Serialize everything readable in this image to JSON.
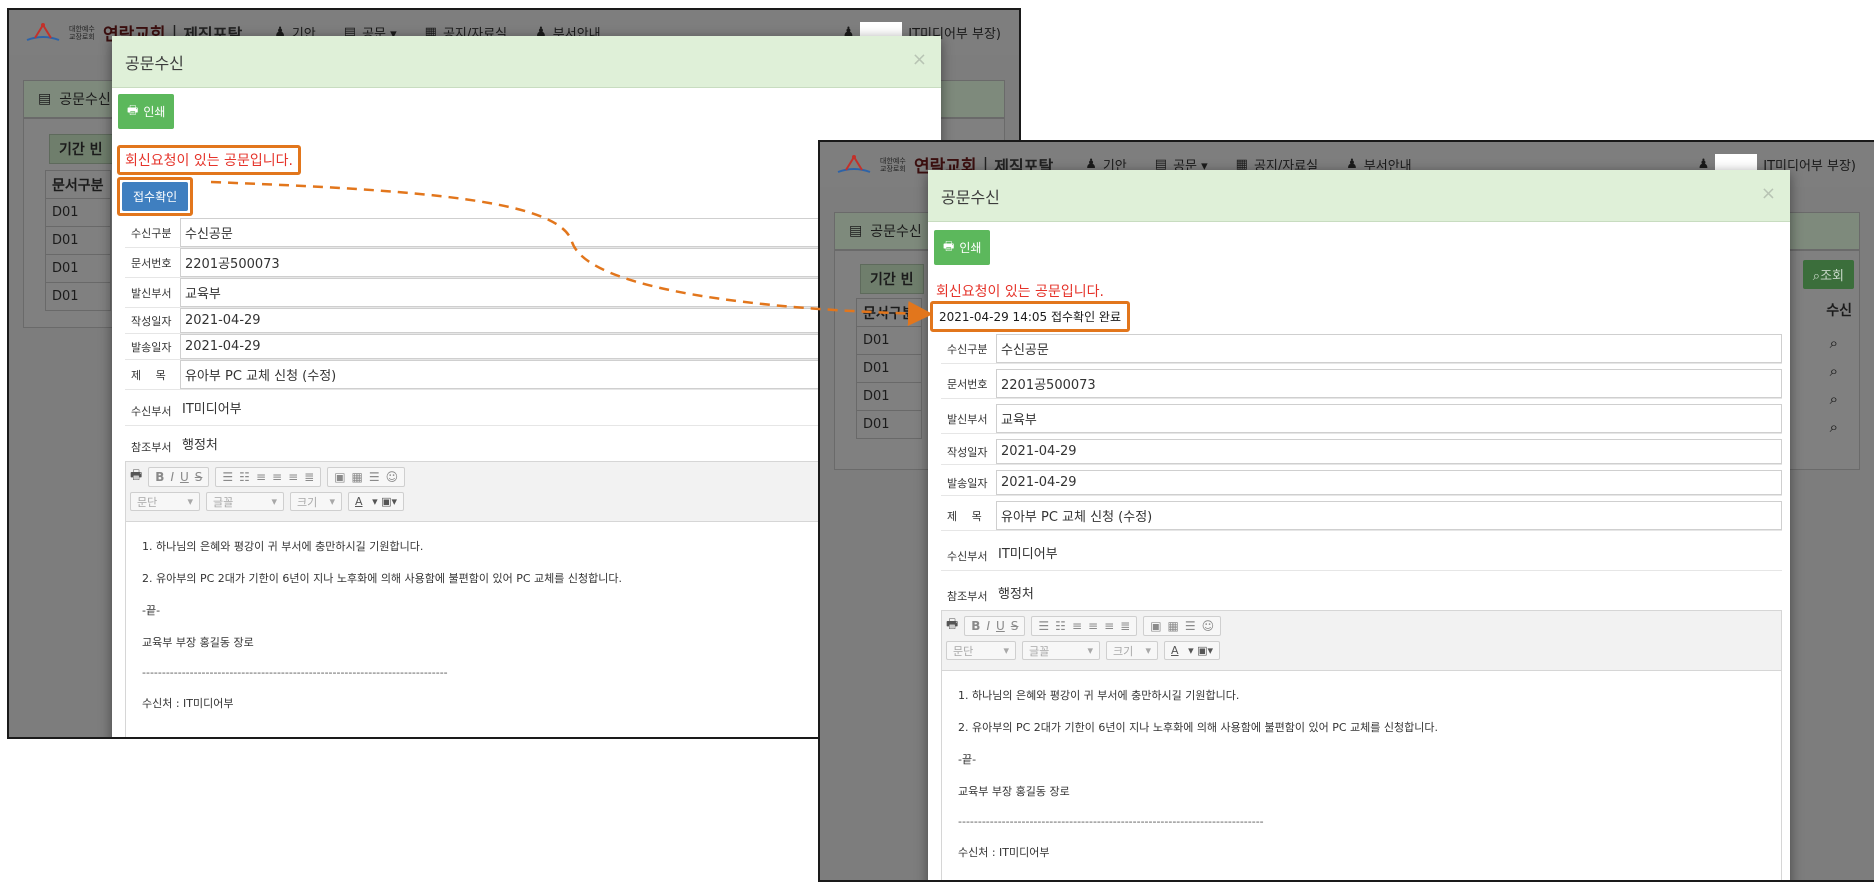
{
  "nav": {
    "logo_small": "대한예수교장로회",
    "logo_big": "연락교회",
    "logo_sep": "|",
    "logo_sub": "제직포탈",
    "items": [
      "기안",
      "공문 ▾",
      "공지/자료실",
      "부서안내"
    ],
    "user": "IT미디어부 부장)"
  },
  "page": {
    "title": "공문수신",
    "filter_label": "기간",
    "filter_label_extra": "빈",
    "search_button": "조회",
    "table_header_doc": "문서구분",
    "table_header_recv": "수신",
    "rows": [
      "D01",
      "D01",
      "D01",
      "D01"
    ]
  },
  "modal": {
    "title": "공문수신",
    "close": "×",
    "print_button": "인쇄",
    "notice": "회신요청이 있는 공문입니다.",
    "ack_button": "접수확인",
    "ack_status": "2021-04-29 14:05 접수확인 완료",
    "fields": [
      {
        "label": "수신구분",
        "value": "수신공문"
      },
      {
        "label": "문서번호",
        "value": "2201공500073"
      },
      {
        "label": "발신부서",
        "value": "교육부"
      },
      {
        "label": "작성일자",
        "value": "2021-04-29"
      },
      {
        "label": "발송일자",
        "value": "2021-04-29"
      },
      {
        "label": "제 　목",
        "value": "유아부 PC 교체 신청 (수정)"
      }
    ],
    "plain_fields": [
      {
        "label": "수신부서",
        "value": "IT미디어부"
      },
      {
        "label": "참조부서",
        "value": "행정처"
      }
    ],
    "editor": {
      "toolbar_row1": [
        "B",
        "I",
        "U",
        "S"
      ],
      "select_paragraph": "문단",
      "select_font": "글꼴",
      "select_size": "크기",
      "font_color": "A",
      "body": [
        "1. 하나님의 은혜와 평강이 귀 부서에 충만하시길 기원합니다.",
        "2. 유아부의 PC 2대가 기한이 6년이 지나 노후화에 의해 사용함에 불편함이 있어 PC 교체를 신청합니다.",
        "-끝-",
        "교육부 부장 홍길동 장로",
        "-----------------------------------------------------------------------------",
        "수신처 : IT미디어부"
      ]
    }
  },
  "colors": {
    "highlight": "#e2761c",
    "notice_red": "#e5332a",
    "modal_header": "#dff0d8",
    "print_green": "#5cb85c",
    "ack_blue": "#3f7fc0"
  }
}
